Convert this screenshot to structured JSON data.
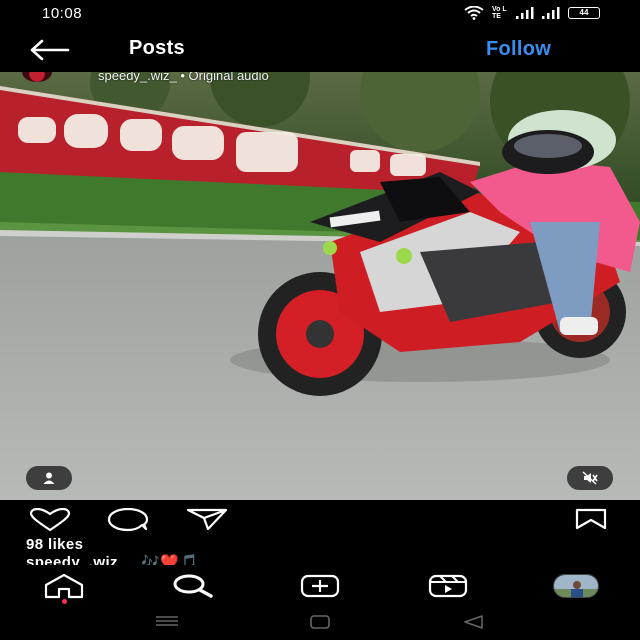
{
  "status_bar": {
    "time": "10:08",
    "volte_label": "Vo LTE",
    "battery_level": "44"
  },
  "header": {
    "title": "Posts",
    "follow_label": "Follow"
  },
  "post": {
    "author": "speedy_.wiz_ • Original audio",
    "likes": "98 likes",
    "caption_user": "speedy_.wiz_",
    "caption_emojis": "🎶❤️🎵"
  },
  "icons": {
    "back": "arrow-left",
    "tagged": "person",
    "mute": "speaker-muted",
    "like": "heart-outline",
    "comment": "speech-bubble",
    "share": "paper-plane",
    "save": "bookmark",
    "home": "home",
    "search": "magnifier",
    "create": "plus-square",
    "reels": "reels",
    "profile": "profile-avatar"
  },
  "colors": {
    "follow": "#3a8df0",
    "background": "#000000",
    "notification_dot": "#ff2d55"
  }
}
